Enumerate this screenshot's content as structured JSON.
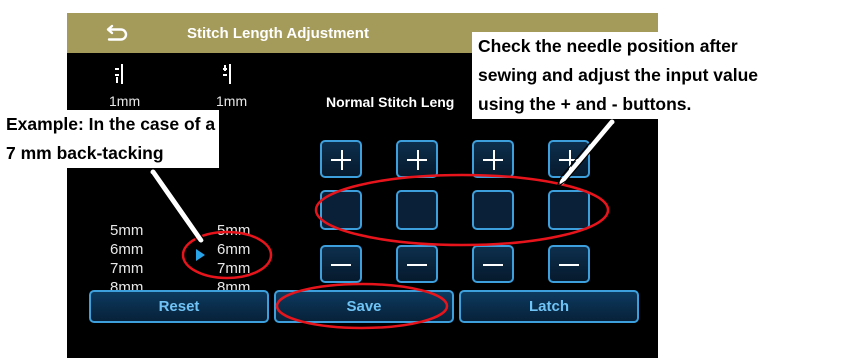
{
  "screen": {
    "title": "Stitch Length Adjustment",
    "top_values": [
      "1mm",
      "1mm"
    ],
    "normal_stitch_label": "Normal Stitch Leng",
    "list_left": [
      "5mm",
      "6mm",
      "7mm",
      "8mm"
    ],
    "list_right": [
      "5mm",
      "6mm",
      "7mm",
      "8mm"
    ],
    "plus_symbol": "+",
    "minus_symbol": "−",
    "buttons": {
      "reset": "Reset",
      "save": "Save",
      "latch": "Latch"
    },
    "colors": {
      "titlebar": "#a49a5a",
      "accent": "#3d9fdc",
      "highlight": "#e8141c"
    }
  },
  "callouts": {
    "right_line1": "Check the needle position after",
    "right_line2": "sewing and adjust the input value",
    "right_line3": "using the + and - buttons.",
    "left_line1": "Example: In the case of a",
    "left_line2": "7 mm back-tacking"
  }
}
